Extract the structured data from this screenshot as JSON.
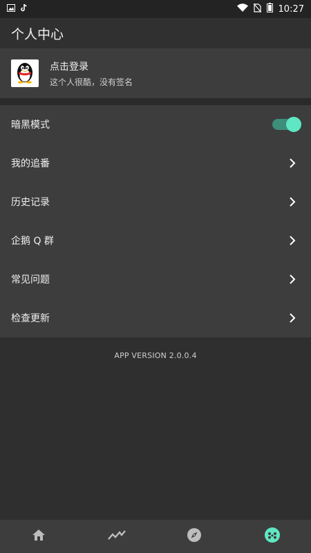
{
  "status_bar": {
    "time": "10:27",
    "left_icons": [
      "image-icon",
      "tiktok-icon"
    ],
    "right_icons": [
      "wifi-icon",
      "no-sim-icon",
      "battery-icon"
    ]
  },
  "header": {
    "title": "个人中心"
  },
  "profile": {
    "name": "点击登录",
    "signature": "这个人很酷，没有签名",
    "avatar_icon": "qq-penguin-icon"
  },
  "menu": {
    "items": [
      {
        "label": "暗黑模式",
        "type": "toggle",
        "value": true
      },
      {
        "label": "我的追番",
        "type": "link"
      },
      {
        "label": "历史记录",
        "type": "link"
      },
      {
        "label": "企鹅 Q 群",
        "type": "link"
      },
      {
        "label": "常见问题",
        "type": "link"
      },
      {
        "label": "检查更新",
        "type": "link"
      }
    ]
  },
  "version_text": "APP VERSION 2.0.0.4",
  "bottom_nav": {
    "items": [
      {
        "icon": "home-icon",
        "active": false
      },
      {
        "icon": "trend-icon",
        "active": false
      },
      {
        "icon": "compass-icon",
        "active": false
      },
      {
        "icon": "face-icon",
        "active": true
      }
    ]
  },
  "colors": {
    "background": "#2f2f2f",
    "card": "#3d3d3d",
    "accent": "#5fe7c3"
  }
}
